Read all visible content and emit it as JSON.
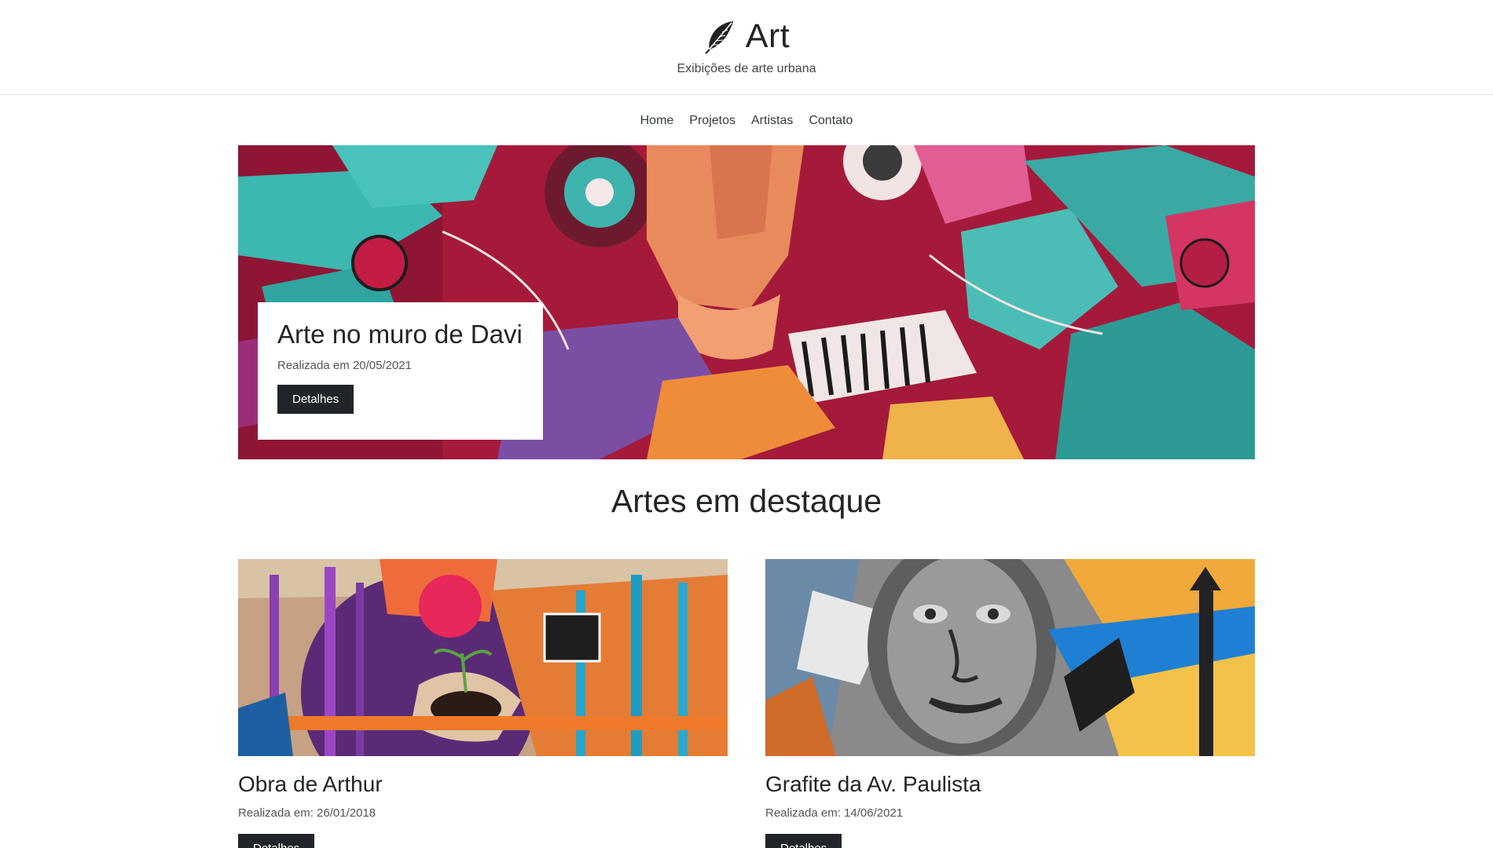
{
  "header": {
    "title": "Art",
    "tagline": "Exibições de arte urbana",
    "icon": "feather-icon"
  },
  "nav": {
    "items": [
      "Home",
      "Projetos",
      "Artistas",
      "Contato"
    ]
  },
  "hero": {
    "title": "Arte no muro de Davi",
    "date": "Realizada em 20/05/2021",
    "button": "Detalhes"
  },
  "featured": {
    "title": "Artes em destaque",
    "cards": [
      {
        "title": "Obra de Arthur",
        "date": "Realizada em: 26/01/2018",
        "button": "Detalhes"
      },
      {
        "title": "Grafite da Av. Paulista",
        "date": "Realizada em: 14/06/2021",
        "button": "Detalhes"
      }
    ]
  },
  "colors": {
    "dark": "#212529",
    "border": "#dee2e6"
  }
}
